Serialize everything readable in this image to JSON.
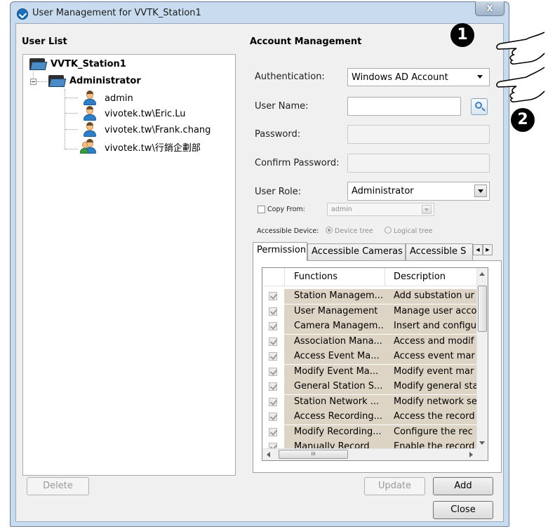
{
  "window": {
    "title": "User Management for VVTK_Station1",
    "close_glyph": "X"
  },
  "user_list": {
    "header": "User List",
    "root": "VVTK_Station1",
    "group": "Administrator",
    "users": [
      "admin",
      "vivotek.tw\\Eric.Lu",
      "vivotek.tw\\Frank.chang",
      "vivotek.tw\\行銷企劃部"
    ],
    "delete_label": "Delete"
  },
  "account": {
    "header": "Account Management",
    "authentication_label": "Authentication:",
    "authentication_value": "Windows AD Account",
    "username_label": "User Name:",
    "username_value": "",
    "password_label": "Password:",
    "confirm_label": "Confirm Password:",
    "role_label": "User Role:",
    "role_value": "Administrator",
    "copy_from_label": "Copy From:",
    "copy_from_value": "admin",
    "accessible_device_label": "Accessible Device:",
    "device_tree_label": "Device tree",
    "logical_tree_label": "Logical tree"
  },
  "tabs": [
    "Permission",
    "Accessible Cameras",
    "Accessible S"
  ],
  "permissions": {
    "columns": [
      "Functions",
      "Description"
    ],
    "rows": [
      {
        "function": "Station Managem...",
        "description": "Add substation ur"
      },
      {
        "function": "User Management",
        "description": "Manage user acco"
      },
      {
        "function": "Camera Managem...",
        "description": "Insert and configu"
      },
      {
        "function": "Association Mana...",
        "description": "Access and modif"
      },
      {
        "function": "Access Event Ma...",
        "description": "Access event mar"
      },
      {
        "function": "Modify Event Ma...",
        "description": "Modify event mar"
      },
      {
        "function": "General Station S...",
        "description": "Modify general sta"
      },
      {
        "function": "Station Network ...",
        "description": "Modify network se"
      },
      {
        "function": "Access Recording...",
        "description": "Access the record"
      },
      {
        "function": "Modify Recording...",
        "description": "Configure the rec"
      },
      {
        "function": "Manually Record",
        "description": "Enable the record"
      }
    ],
    "hscroll_grip": "III"
  },
  "buttons": {
    "update": "Update",
    "add": "Add",
    "close": "Close"
  },
  "callouts": [
    "1",
    "2"
  ],
  "colors": {
    "row_bg": "#ded4c5",
    "frame": "#c9dcef"
  }
}
